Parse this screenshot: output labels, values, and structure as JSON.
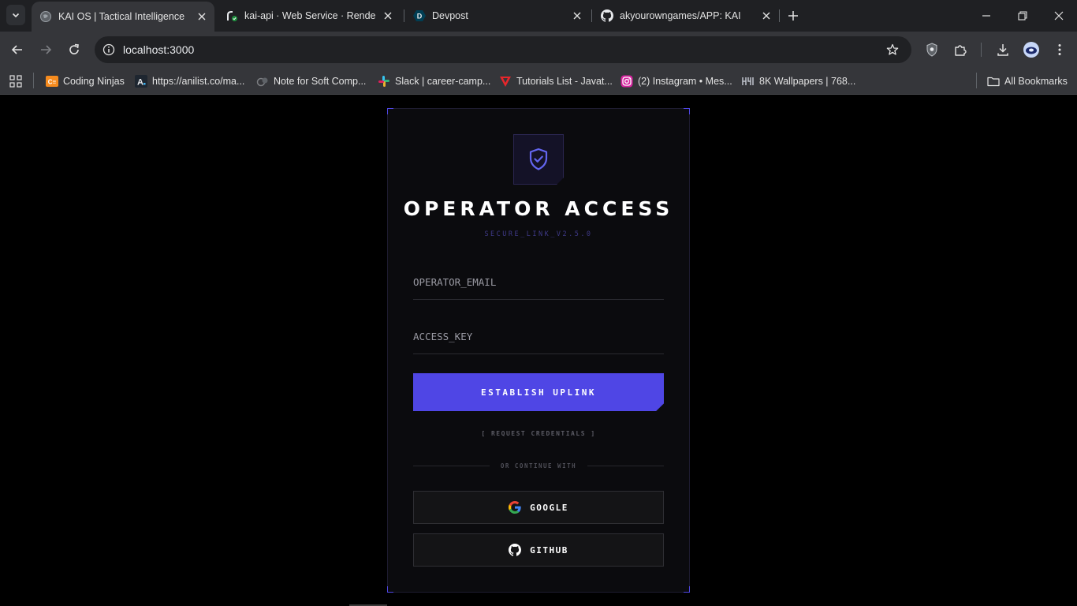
{
  "browser": {
    "tabs": [
      {
        "title": "KAI OS | Tactical Intelligence",
        "icon": "globe-icon",
        "active": true
      },
      {
        "title": "kai-api · Web Service · Render",
        "icon": "render-icon",
        "active": false
      },
      {
        "title": "Devpost",
        "icon": "devpost-icon",
        "active": false
      },
      {
        "title": "akyourowngames/APP: KAI",
        "icon": "github-icon",
        "active": false
      }
    ],
    "url": "localhost:3000",
    "bookmarks": [
      {
        "label": "Coding Ninjas",
        "icon": "coding-ninjas-icon"
      },
      {
        "label": "https://anilist.co/ma...",
        "icon": "anilist-icon"
      },
      {
        "label": "Note for Soft Comp...",
        "icon": "note-icon"
      },
      {
        "label": "Slack | career-camp...",
        "icon": "slack-icon"
      },
      {
        "label": "Tutorials List - Javat...",
        "icon": "javatpoint-icon"
      },
      {
        "label": "(2) Instagram • Mes...",
        "icon": "instagram-icon"
      },
      {
        "label": "8K Wallpapers | 768...",
        "icon": "wallpapers-icon"
      }
    ],
    "all_bookmarks_label": "All Bookmarks"
  },
  "login": {
    "title": "OPERATOR ACCESS",
    "subtitle": "SECURE_LINK_V2.5.0",
    "email_placeholder": "OPERATOR_EMAIL",
    "password_placeholder": "ACCESS_KEY",
    "submit_label": "ESTABLISH UPLINK",
    "request_label": "[ REQUEST CREDENTIALS ]",
    "divider_label": "OR CONTINUE WITH",
    "google_label": "GOOGLE",
    "github_label": "GITHUB"
  },
  "colors": {
    "accent": "#4f46e5",
    "page_background": "#000000",
    "card_background": "#0b0b0e",
    "chrome_background": "#35363a"
  }
}
